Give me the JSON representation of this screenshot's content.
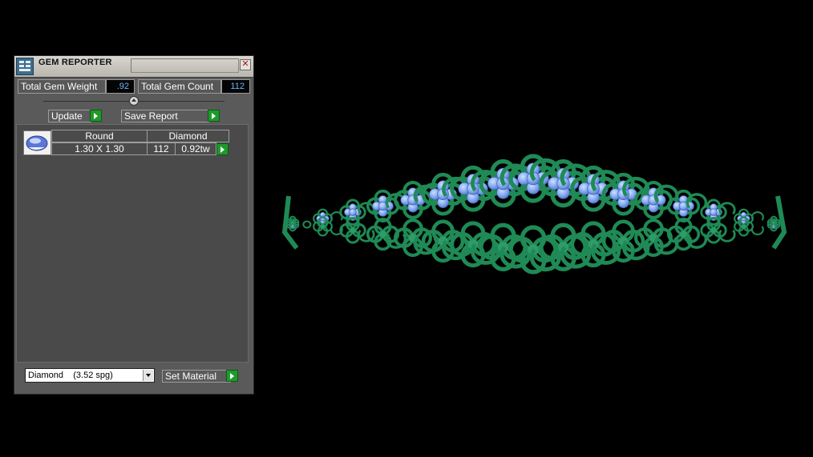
{
  "window": {
    "title": "GEM REPORTER",
    "close_glyph": "✕"
  },
  "stats": {
    "weight_label": "Total Gem Weight",
    "weight_value": ".92",
    "count_label": "Total Gem Count",
    "count_value": "112"
  },
  "buttons": {
    "update": "Update",
    "save_report": "Save Report",
    "set_material": "Set Material"
  },
  "report": {
    "headers": [
      "Round",
      "Diamond"
    ],
    "rows": [
      {
        "size": "1.30 X 1.30",
        "count": "112",
        "weight": "0.92tw"
      }
    ]
  },
  "material": {
    "selected": "Diamond    (3.52 spg)"
  },
  "colors": {
    "metal": "#1f8a55",
    "gem": "#7fa6f0",
    "accent_go": "#1f9a2b",
    "value_text": "#6fb4ff"
  },
  "icons": [
    "gem-reporter-app-icon",
    "close-icon",
    "slider-knob-icon",
    "play-arrow-icon",
    "round-gem-icon",
    "dropdown-arrow-icon"
  ]
}
